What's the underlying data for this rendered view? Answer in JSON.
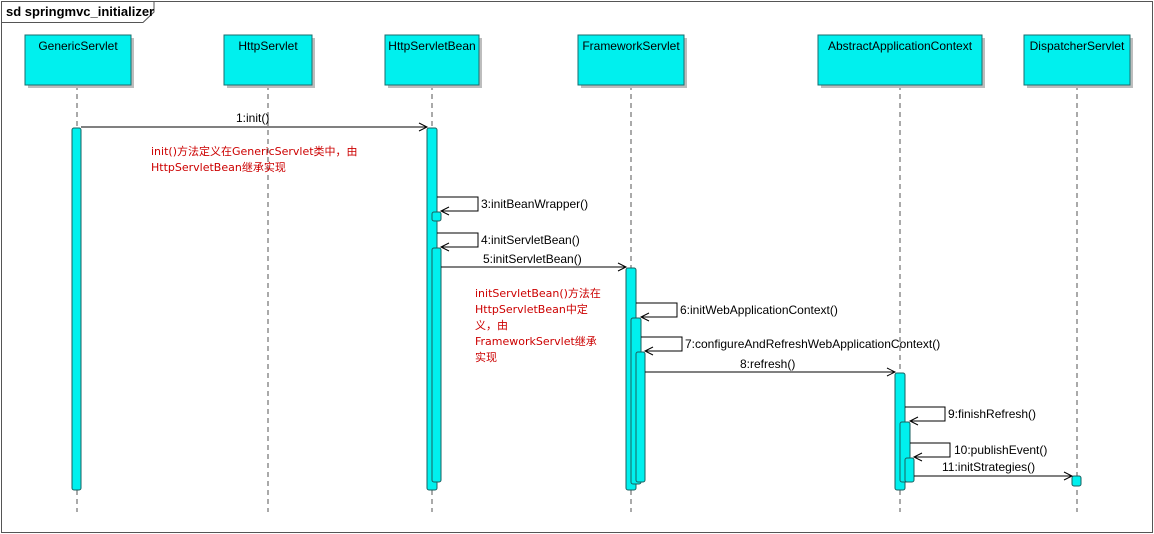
{
  "diagram": {
    "title": "sd springmvc_initializer",
    "lifelines": [
      {
        "id": "generic",
        "label": "GenericServlet"
      },
      {
        "id": "http",
        "label": "HttpServlet"
      },
      {
        "id": "bean",
        "label": "HttpServletBean"
      },
      {
        "id": "framework",
        "label": "FrameworkServlet"
      },
      {
        "id": "context",
        "label": "AbstractApplicationContext"
      },
      {
        "id": "dispatcher",
        "label": "DispatcherServlet"
      }
    ],
    "messages": [
      {
        "label": "1:init()"
      },
      {
        "label": "3:initBeanWrapper()"
      },
      {
        "label": "4:initServletBean()"
      },
      {
        "label": "5:initServletBean()"
      },
      {
        "label": "6:initWebApplicationContext()"
      },
      {
        "label": "7:configureAndRefreshWebApplicationContext()"
      },
      {
        "label": "8:refresh()"
      },
      {
        "label": "9:finishRefresh()"
      },
      {
        "label": "10:publishEvent()"
      },
      {
        "label": "11:initStrategies()"
      }
    ],
    "notes": [
      {
        "lines": [
          "init()方法定义在GenericServlet类中，由",
          "HttpServletBean继承实现"
        ]
      },
      {
        "lines": [
          "initServletBean()方法在",
          "HttpServletBean中定",
          "义，由",
          "FrameworkServlet继承",
          "实现"
        ]
      }
    ]
  },
  "colors": {
    "lifeline_fill": "#00f0ee",
    "note_text": "#cc0000"
  }
}
